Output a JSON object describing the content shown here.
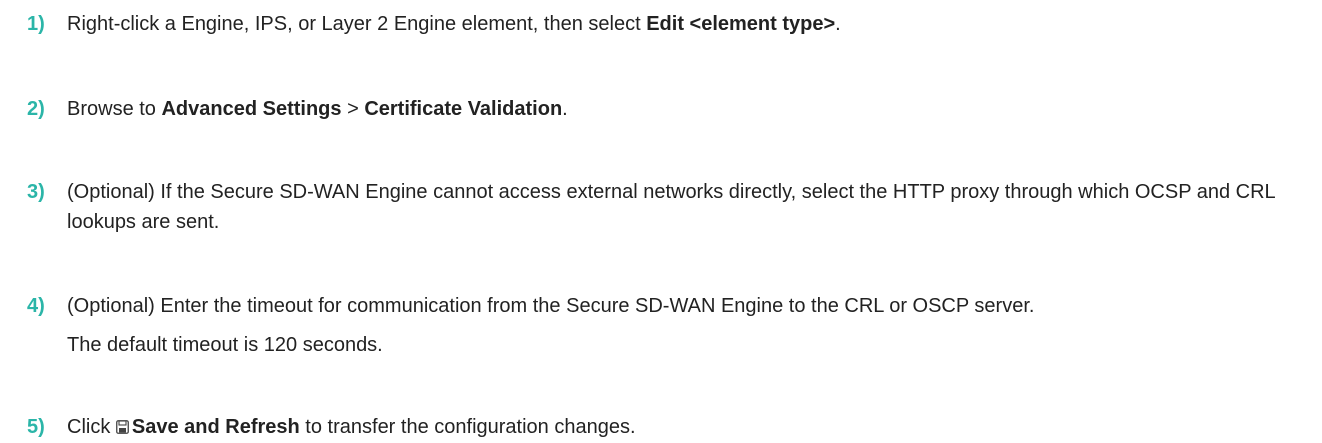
{
  "accent_color": "#2BB5A8",
  "steps": [
    {
      "number": "1)",
      "pre": "Right-click a Engine, IPS, or Layer 2 Engine element, then select ",
      "bold1": "Edit <element type>",
      "post": "."
    },
    {
      "number": "2)",
      "pre": "Browse to ",
      "bold1": "Advanced Settings",
      "mid": " > ",
      "bold2": "Certificate Validation",
      "post": "."
    },
    {
      "number": "3)",
      "text": "(Optional) If the Secure SD-WAN Engine cannot access external networks directly, select the HTTP proxy through which OCSP and CRL lookups are sent."
    },
    {
      "number": "4)",
      "text": "(Optional) Enter the timeout for communication from the Secure SD-WAN Engine to the CRL or OSCP server.",
      "note": "The default timeout is 120 seconds."
    },
    {
      "number": "5)",
      "pre": "Click ",
      "icon": "save-icon",
      "bold1": "Save and Refresh",
      "post": " to transfer the configuration changes."
    }
  ]
}
